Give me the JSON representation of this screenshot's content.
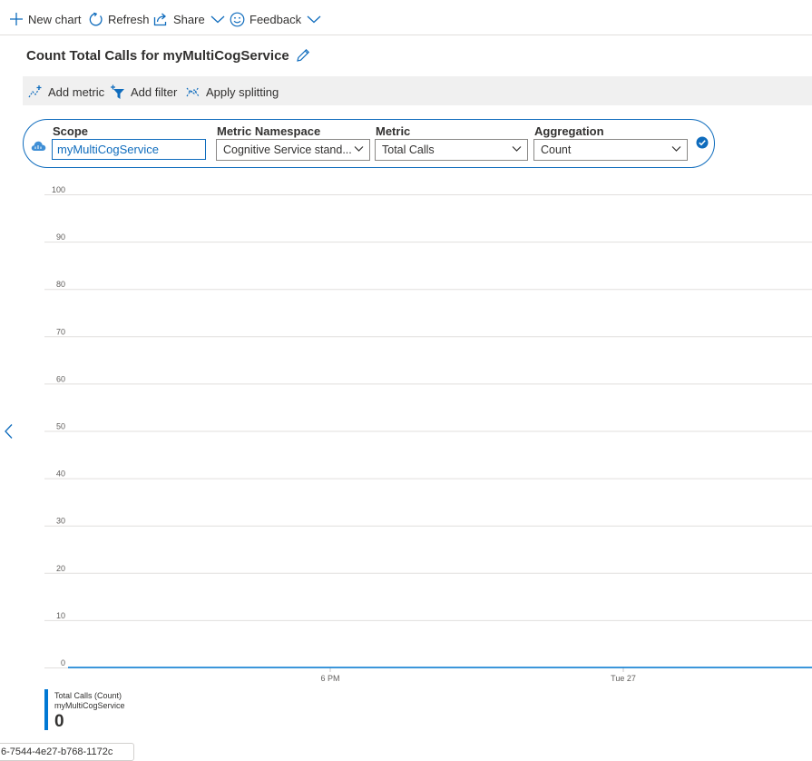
{
  "toolbar": {
    "new_chart": "New chart",
    "refresh": "Refresh",
    "share": "Share",
    "feedback": "Feedback"
  },
  "chart_title": "Count Total Calls for myMultiCogService",
  "chart_toolbar": {
    "add_metric": "Add metric",
    "add_filter": "Add filter",
    "apply_splitting": "Apply splitting"
  },
  "metric_selector": {
    "scope_label": "Scope",
    "scope_value": "myMultiCogService",
    "namespace_label": "Metric Namespace",
    "namespace_value": "Cognitive Service stand...",
    "metric_label": "Metric",
    "metric_value": "Total Calls",
    "aggregation_label": "Aggregation",
    "aggregation_value": "Count"
  },
  "chart_data": {
    "type": "line",
    "ylim": [
      0,
      100
    ],
    "yticks": [
      "100",
      "90",
      "80",
      "70",
      "60",
      "50",
      "40",
      "30",
      "20",
      "10",
      "0"
    ],
    "xticks": [
      "6 PM",
      "Tue 27"
    ],
    "series": [
      {
        "name": "Total Calls (Count)",
        "values": [
          0,
          0
        ]
      }
    ],
    "grid": true
  },
  "legend": {
    "series_name": "Total Calls (Count)",
    "resource": "myMultiCogService",
    "value": "0"
  },
  "bottom_tooltip": "6-7544-4e27-b768-1172c",
  "colors": {
    "accent": "#0078d4",
    "border_blue": "#0f6cbd",
    "toolbar_bg": "#f0f0f0"
  }
}
